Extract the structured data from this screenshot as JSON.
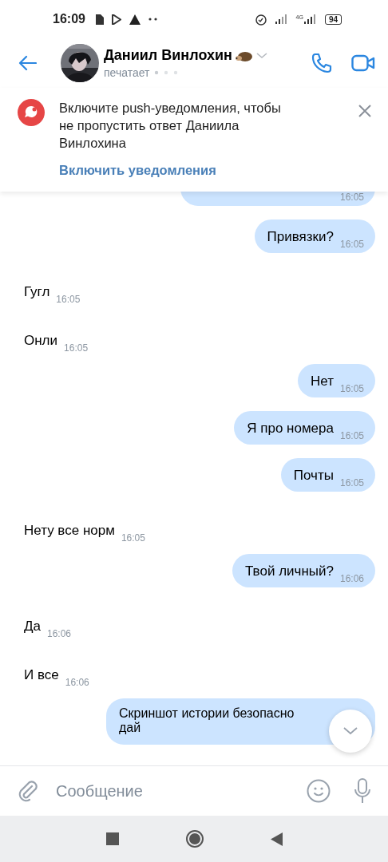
{
  "status_bar": {
    "time": "16:09",
    "network": "4G",
    "battery": "94"
  },
  "header": {
    "name": "Даниил Винлохин",
    "status": "печатает"
  },
  "banner": {
    "text": "Включите push-уведомления, чтобы не пропустить ответ Даниила Винлохина",
    "action": "Включить уведомления"
  },
  "messages": [
    {
      "kind": "partial",
      "outgoing": true,
      "time": "16:05"
    },
    {
      "kind": "text",
      "outgoing": true,
      "text": "Привязки?",
      "time": "16:05"
    },
    {
      "kind": "text",
      "outgoing": false,
      "text": "Гугл",
      "time": "16:05"
    },
    {
      "kind": "text",
      "outgoing": false,
      "text": "Онли",
      "time": "16:05"
    },
    {
      "kind": "text",
      "outgoing": true,
      "text": "Нет",
      "time": "16:05"
    },
    {
      "kind": "text",
      "outgoing": true,
      "text": "Я про номера",
      "time": "16:05"
    },
    {
      "kind": "text",
      "outgoing": true,
      "text": "Почты",
      "time": "16:05"
    },
    {
      "kind": "text",
      "outgoing": false,
      "text": "Нету все норм",
      "time": "16:05"
    },
    {
      "kind": "text",
      "outgoing": true,
      "text": "Твой личный?",
      "time": "16:06"
    },
    {
      "kind": "text",
      "outgoing": false,
      "text": "Да",
      "time": "16:06"
    },
    {
      "kind": "text",
      "outgoing": false,
      "text": "И все",
      "time": "16:06"
    },
    {
      "kind": "long",
      "outgoing": true,
      "lines": [
        "Скриншот истории безопасно",
        "дай"
      ]
    }
  ],
  "composer": {
    "placeholder": "Сообщение"
  }
}
